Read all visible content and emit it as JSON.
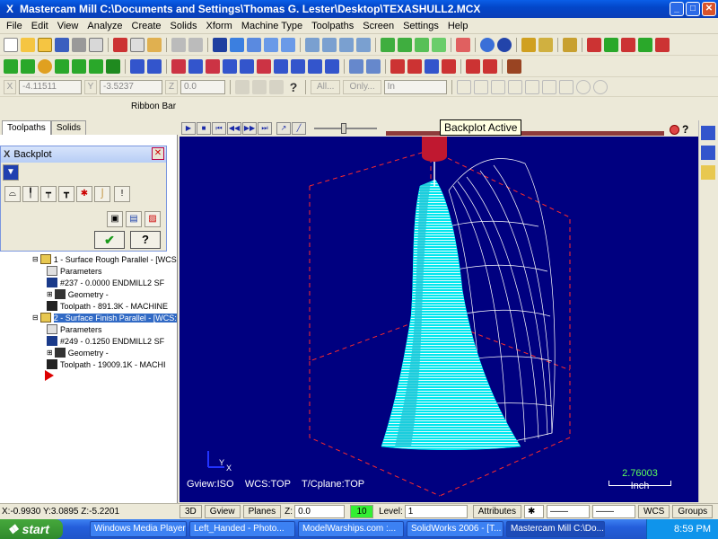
{
  "window": {
    "title": "Mastercam Mill  C:\\Documents and Settings\\Thomas G. Lester\\Desktop\\TEXASHULL2.MCX"
  },
  "menu": [
    "File",
    "Edit",
    "View",
    "Analyze",
    "Create",
    "Solids",
    "Xform",
    "Machine Type",
    "Toolpaths",
    "Screen",
    "Settings",
    "Help"
  ],
  "coords": {
    "x_label": "X",
    "x_value": "-4.11511",
    "y_label": "Y",
    "y_value": "-3.5237",
    "z_label": "Z",
    "z_value": "0.0",
    "all": "All...",
    "only": "Only...",
    "in_value": "In"
  },
  "ribbon_bar": "Ribbon Bar",
  "tabs": [
    "Toolpaths",
    "Solids"
  ],
  "backplot": {
    "title": "Backplot",
    "ok_icon": "✔",
    "help_icon": "?"
  },
  "tree": [
    {
      "text": "1 - Surface Rough Parallel - [WCS",
      "icon": "folder-icon"
    },
    {
      "text": "Parameters",
      "icon": "parameters-icon"
    },
    {
      "text": "#237 - 0.0000 ENDMILL2 SF",
      "icon": "tool-icon"
    },
    {
      "text": "Geometry -",
      "icon": "geometry-icon"
    },
    {
      "text": "Toolpath - 891.3K - MACHINE",
      "icon": "toolpath-icon"
    },
    {
      "text": "2 - Surface Finish Parallel - [WCS:",
      "icon": "folder-icon"
    },
    {
      "text": "Parameters",
      "icon": "parameters-icon"
    },
    {
      "text": "#249 - 0.1250 ENDMILL2 SF",
      "icon": "tool-icon"
    },
    {
      "text": "Geometry -",
      "icon": "geometry-icon"
    },
    {
      "text": "Toolpath - 19009.1K - MACHI",
      "icon": "toolpath-icon"
    }
  ],
  "viewport": {
    "tooltip": "Backplot Active",
    "gview": "Gview:ISO",
    "wcs": "WCS:TOP",
    "tcplane": "T/Cplane:TOP",
    "scale_value": "2.76003",
    "scale_unit": "Inch",
    "axis_x": "X",
    "axis_y": "Y"
  },
  "status": {
    "d3": "3D",
    "gview": "Gview",
    "planes": "Planes",
    "z_label": "Z:",
    "z_value": "0.0",
    "color_value": "10",
    "level_label": "Level:",
    "level_value": "1",
    "attributes": "Attributes",
    "wcs": "WCS",
    "groups": "Groups"
  },
  "coords_readout": "X:-0.9930   Y:3.0895   Z:-5.2201",
  "taskbar": {
    "start": "start",
    "tasks": [
      "Windows Media Player",
      "Left_Handed - Photo...",
      "ModelWarships.com :...",
      "SolidWorks 2006 - [T...",
      "Mastercam Mill  C:\\Do..."
    ],
    "clock": "8:59 PM"
  },
  "colors": {
    "viewport_bg": "#000080",
    "titlebar": "#0346c9",
    "mesh": "#00ffff",
    "wire": "#ffffff",
    "bbox": "#ff3030"
  }
}
